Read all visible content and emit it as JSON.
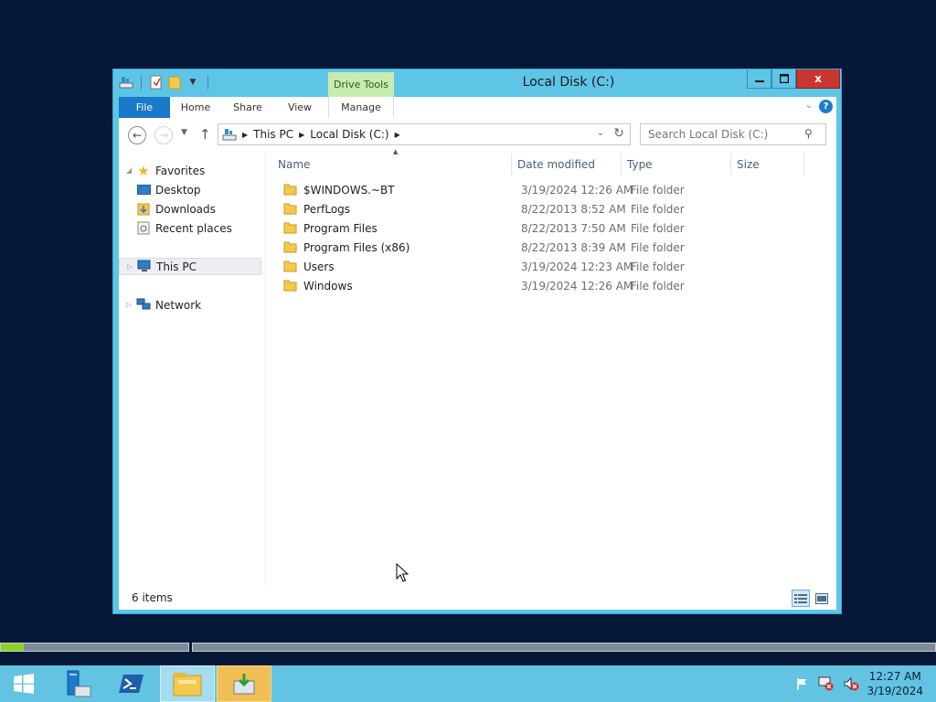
{
  "window": {
    "title": "Local Disk (C:)",
    "contextual_tab_header": "Drive Tools",
    "close_glyph": "x"
  },
  "ribbon": {
    "tabs": [
      {
        "label": "File",
        "active": true
      },
      {
        "label": "Home"
      },
      {
        "label": "Share"
      },
      {
        "label": "View"
      },
      {
        "label": "Manage"
      }
    ]
  },
  "address": {
    "crumbs": [
      "This PC",
      "Local Disk (C:)"
    ],
    "search_placeholder": "Search Local Disk (C:)"
  },
  "nav_pane": {
    "favorites_label": "Favorites",
    "favorites": [
      "Desktop",
      "Downloads",
      "Recent places"
    ],
    "this_pc_label": "This PC",
    "network_label": "Network"
  },
  "columns": [
    "Name",
    "Date modified",
    "Type",
    "Size"
  ],
  "files": [
    {
      "name": "$WINDOWS.~BT",
      "date": "3/19/2024 12:26 AM",
      "type": "File folder"
    },
    {
      "name": "PerfLogs",
      "date": "8/22/2013 8:52 AM",
      "type": "File folder"
    },
    {
      "name": "Program Files",
      "date": "8/22/2013 7:50 AM",
      "type": "File folder"
    },
    {
      "name": "Program Files (x86)",
      "date": "8/22/2013 8:39 AM",
      "type": "File folder"
    },
    {
      "name": "Users",
      "date": "3/19/2024 12:23 AM",
      "type": "File folder"
    },
    {
      "name": "Windows",
      "date": "3/19/2024 12:26 AM",
      "type": "File folder"
    }
  ],
  "status": {
    "item_count": "6 items"
  },
  "progress": {
    "fraction": 0.12
  },
  "taskbar": {
    "icons": [
      "windows-start-icon",
      "server-manager-icon",
      "powershell-icon",
      "file-explorer-icon",
      "active-app-icon"
    ]
  },
  "clock": {
    "time": "12:27 AM",
    "date": "3/19/2024"
  },
  "colors": {
    "desktop": "#051838",
    "window_frame": "#5fc5e6",
    "file_tab": "#1979ca",
    "close_button": "#c7372f",
    "context_tab": "#c8ecb0",
    "taskbar": "#62c3e3",
    "active_task": "#f1bf55",
    "progress_fill": "#8bd12a"
  }
}
